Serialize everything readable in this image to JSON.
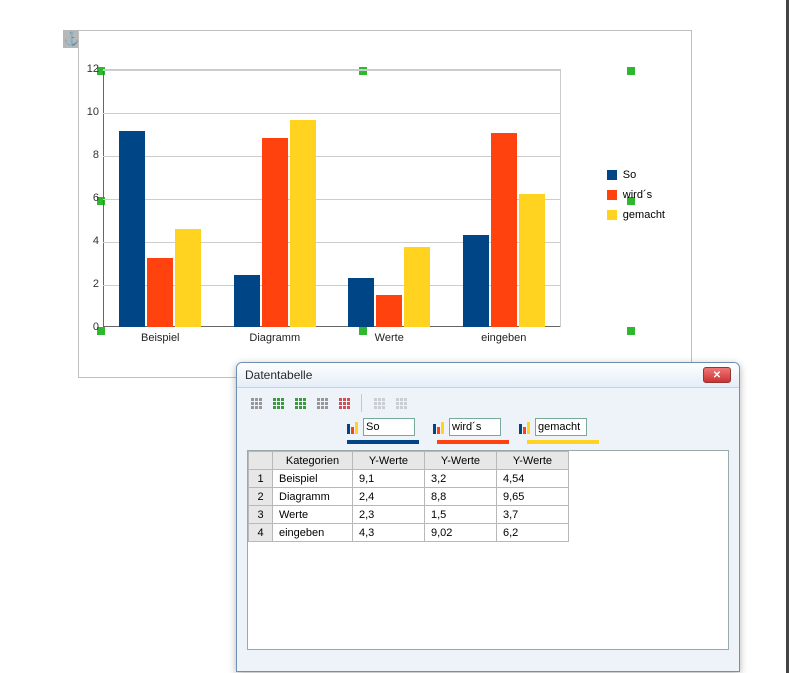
{
  "anchor_icon": "⚓",
  "chart_data": {
    "type": "bar",
    "categories": [
      "Beispiel",
      "Diagramm",
      "Werte",
      "eingeben"
    ],
    "series": [
      {
        "name": "So",
        "values": [
          9.1,
          2.4,
          2.3,
          4.3
        ],
        "color": "#004586"
      },
      {
        "name": "wird´s",
        "values": [
          3.2,
          8.8,
          1.5,
          9.02
        ],
        "color": "#ff420e"
      },
      {
        "name": "gemacht",
        "values": [
          4.54,
          9.65,
          3.7,
          6.2
        ],
        "color": "#ffd320"
      }
    ],
    "ylim": [
      0,
      12
    ],
    "yticks": [
      0,
      2,
      4,
      6,
      8,
      10,
      12
    ],
    "xlabel": "",
    "ylabel": "",
    "title": ""
  },
  "legend": {
    "items": [
      "So",
      "wird´s",
      "gemacht"
    ]
  },
  "dialog": {
    "title": "Datentabelle",
    "series_inputs": [
      "So",
      "wird´s",
      "gemacht"
    ],
    "headers": {
      "kategorien": "Kategorien",
      "ywerte": "Y-Werte"
    },
    "rows": [
      {
        "n": "1",
        "cat": "Beispiel",
        "v": [
          "9,1",
          "3,2",
          "4,54"
        ]
      },
      {
        "n": "2",
        "cat": "Diagramm",
        "v": [
          "2,4",
          "8,8",
          "9,65"
        ]
      },
      {
        "n": "3",
        "cat": "Werte",
        "v": [
          "2,3",
          "1,5",
          "3,7"
        ]
      },
      {
        "n": "4",
        "cat": "eingeben",
        "v": [
          "4,3",
          "9,02",
          "6,2"
        ]
      }
    ]
  }
}
